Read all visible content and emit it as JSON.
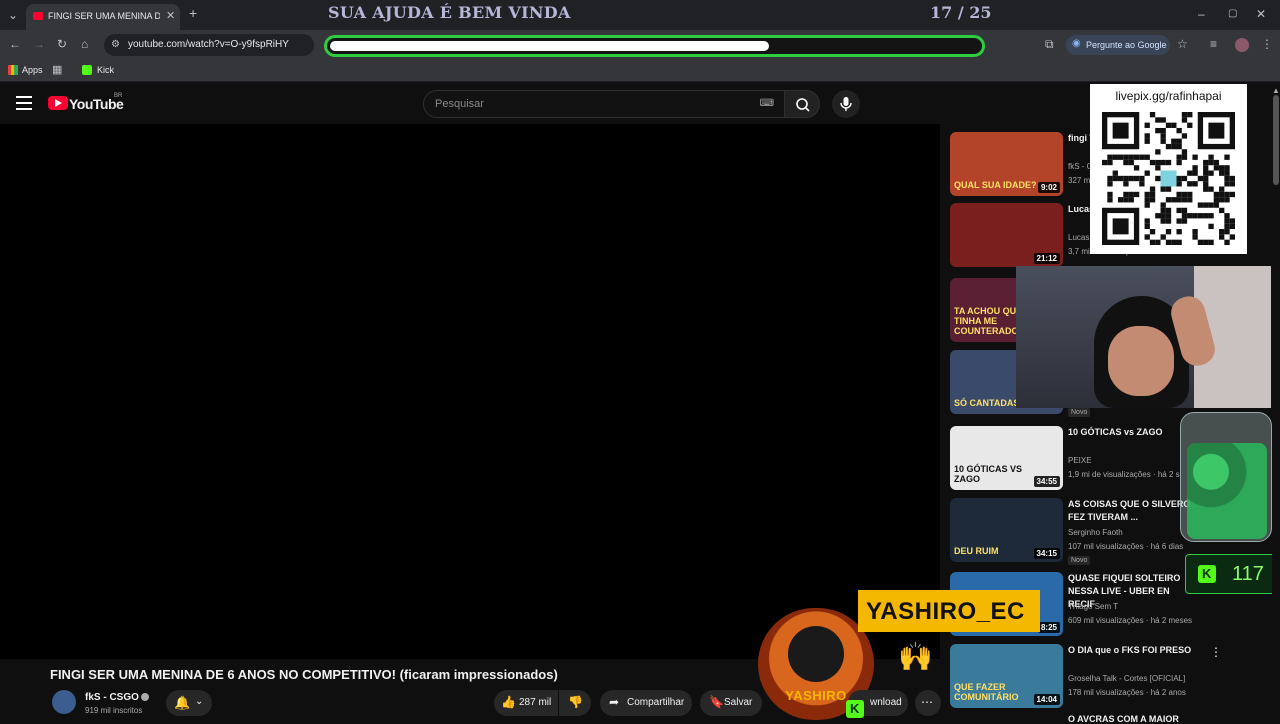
{
  "browser": {
    "tab_title": "FINGI SER UMA MENINA DE 6 /",
    "url": "youtube.com/watch?v=O-y9fspRiHY",
    "ask_google": "Pergunte ao Google",
    "bookmarks": {
      "apps": "Apps",
      "kick": "Kick"
    }
  },
  "overlay": {
    "title": "SUA AJUDA É BEM VINDA",
    "count": "17 / 25",
    "goal_progress": 0.68,
    "pix_label": "livepix.gg/rafinhapai",
    "streamer_name": "YASHIRO_EC",
    "kick_viewers": "117",
    "logo_text": "YASHIRO"
  },
  "youtube": {
    "logo": "YouTube",
    "region": "BR",
    "search_placeholder": "Pesquisar",
    "video_title": "FINGI SER UMA MENINA DE 6 ANOS NO COMPETITIVO! (ficaram impressionados)",
    "channel_name": "fkS - CSGO",
    "subscribers": "919 mil inscritos",
    "likes": "287 mil",
    "share": "Compartilhar",
    "save": "Salvar",
    "download": "wnload",
    "recommendations": [
      {
        "title": "fingi WAV",
        "channel": "fkS - C",
        "meta": "327 m",
        "duration": "9:02",
        "thumb_color": "#b3442a",
        "thumb_text": "QUAL SUA IDADE?"
      },
      {
        "title": "Lucas PARA",
        "channel": "Lucas",
        "meta": "3,7 mil visualizações · há 1 hora",
        "duration": "21:12",
        "thumb_color": "#7a1e1e",
        "thumb_text": ""
      },
      {
        "title": "",
        "channel": "",
        "meta": "",
        "duration": "",
        "thumb_color": "#5a1f33",
        "thumb_text": "TA ACHOU QUE TINHA ME COUNTERADO!"
      },
      {
        "title": "",
        "channel": "",
        "meta": "",
        "duration": "",
        "thumb_color": "#3a4a6a",
        "thumb_text": "SÓ CANTADAS"
      },
      {
        "title": "10 GÓTICAS vs ZAGO",
        "channel": "PEIXE",
        "meta": "1,9 mi de visualizações · há 2 s",
        "duration": "34:55",
        "thumb_color": "#e8e8e8",
        "thumb_text": "10 GÓTICAS VS ZAGO"
      },
      {
        "title": "AS COISAS QUE O SILVERO FEZ TIVERAM ...",
        "channel": "Serginho Faoth",
        "meta": "107 mil visualizações · há 6 dias",
        "duration": "34:15",
        "thumb_color": "#1e2a3a",
        "thumb_text": "DEU RUIM"
      },
      {
        "title": "QUASE FIQUEI SOLTEIRO NESSA LIVE - UBER EN RECIF",
        "channel": "Thiago Sem T",
        "meta": "609 mil visualizações · há 2 meses",
        "duration": "8:25",
        "thumb_color": "#2a6aa8",
        "thumb_text": ""
      },
      {
        "title": "O DIA que o FKS FOI PRESO",
        "channel": "Groselha Talk - Cortes [OFICIAL]",
        "meta": "178 mil visualizações · há 2 anos",
        "duration": "14:04",
        "thumb_color": "#3a7a9a",
        "thumb_text": "QUE FAZER COMUNITÁRIO"
      }
    ],
    "badge_new": "Novo",
    "partial_next": "O AVCRAS COM A MAIOR"
  },
  "colors": {
    "accent_green": "#2ecc40",
    "yt_red": "#ff0033",
    "tag_yellow": "#f5b800"
  }
}
